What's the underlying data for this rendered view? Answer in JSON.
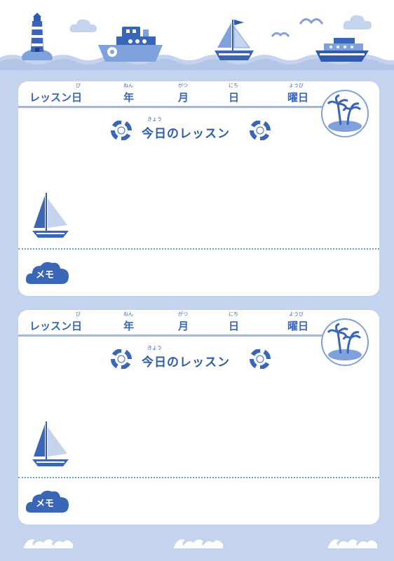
{
  "colors": {
    "primary": "#3a66b8",
    "light": "#c4d4ee",
    "medium": "#7fa2dc",
    "dark": "#2e5cae"
  },
  "cards": [
    {
      "date_fields": [
        {
          "label": "レッスン日",
          "ruby": "び"
        },
        {
          "label": "年",
          "ruby": "ねん"
        },
        {
          "label": "月",
          "ruby": "がつ"
        },
        {
          "label": "日",
          "ruby": "にち"
        },
        {
          "label": "曜日",
          "ruby": "ようび"
        }
      ],
      "title": "今日のレッスン",
      "title_ruby": "きょう",
      "memo_label": "メモ"
    },
    {
      "date_fields": [
        {
          "label": "レッスン日",
          "ruby": "び"
        },
        {
          "label": "年",
          "ruby": "ねん"
        },
        {
          "label": "月",
          "ruby": "がつ"
        },
        {
          "label": "日",
          "ruby": "にち"
        },
        {
          "label": "曜日",
          "ruby": "ようび"
        }
      ],
      "title": "今日のレッスン",
      "title_ruby": "きょう",
      "memo_label": "メモ"
    }
  ],
  "icons": [
    "lighthouse-icon",
    "cloud-icon",
    "steamship-icon",
    "sailboat-icon",
    "seagull-icon",
    "cruise-ship-icon",
    "palm-island-icon",
    "life-ring-icon",
    "wave-icon"
  ]
}
